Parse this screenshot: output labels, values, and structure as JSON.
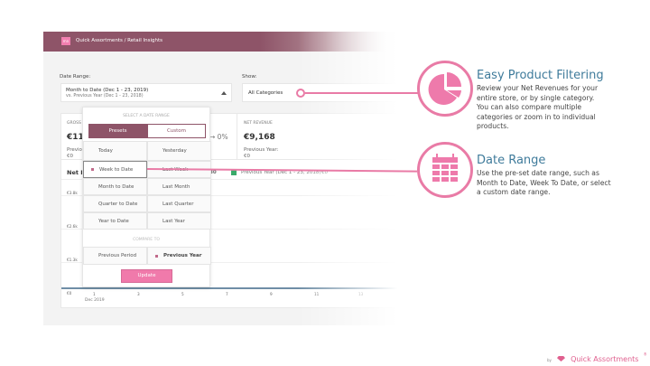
{
  "header": {
    "logo_text": "mn",
    "breadcrumb": "Quick Assortments / Retail Insights"
  },
  "filters": {
    "date_label": "Date Range:",
    "date_value": "Month to Date (Dec 1 - 23, 2019)",
    "date_compare": "vs. Previous Year (Dec 1 - 23, 2018)",
    "show_label": "Show:",
    "show_value": "All Categories"
  },
  "stats": {
    "gross_label": "GROSS",
    "gross_value": "€11,4",
    "gross_prev_label": "Previou",
    "gross_prev_value": "€0",
    "change": "→ 0%",
    "net_label": "NET REVENUE",
    "net_value": "€9,168",
    "net_prev_label": "Previous Year:",
    "net_prev_value": "€0"
  },
  "chart": {
    "title": "Net P",
    "value_partial": "80",
    "legend_prev": "Previous Year (Dec 1 - 23, 2018)",
    "legend_prev_value": "€0",
    "y_ticks": [
      "€3.8k",
      "€2.6k",
      "€1.3k",
      "€0"
    ],
    "x_ticks": [
      "1",
      "3",
      "5",
      "7",
      "9",
      "11",
      "13"
    ],
    "x_sub": "Dec 2019"
  },
  "dropdown": {
    "heading": "SELECT A DATE RANGE",
    "tabs": [
      "Presets",
      "Custom"
    ],
    "active_tab": "Presets",
    "presets": [
      [
        "Today",
        "Yesterday"
      ],
      [
        "Week to Date",
        "Last Week"
      ],
      [
        "Month to Date",
        "Last Month"
      ],
      [
        "Quarter to Date",
        "Last Quarter"
      ],
      [
        "Year to Date",
        "Last Year"
      ]
    ],
    "selected_preset": "Week to Date",
    "compare_heading": "COMPARE TO",
    "compare": [
      "Previous Period",
      "Previous Year"
    ],
    "selected_compare": "Previous Year",
    "update": "Update"
  },
  "features": [
    {
      "title": "Easy Product Filtering",
      "icon": "pie-chart-icon",
      "body": [
        "Review your Net Revenues for your",
        "entire store, or by single category.",
        "You can also compare multiple",
        "categories or zoom in to individual",
        "products."
      ]
    },
    {
      "title": "Date Range",
      "icon": "calendar-icon",
      "body": [
        "Use the pre-set date range, such as",
        "Month to Date, Week To Date, or select",
        "a custom date range."
      ]
    }
  ],
  "footer": {
    "by": "by",
    "brand": "Quick Assortments",
    "mark": "®"
  },
  "colors": {
    "header": "#8e5468",
    "accent": "#e97ba6",
    "title": "#3f7b9b"
  }
}
